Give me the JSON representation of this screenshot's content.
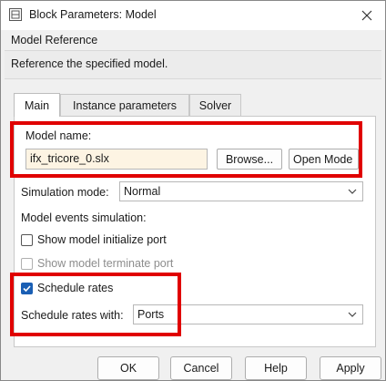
{
  "window": {
    "title": "Block Parameters: Model",
    "close_icon": "close-icon"
  },
  "group": {
    "title": "Model Reference",
    "description": "Reference the specified model."
  },
  "tabs": [
    {
      "label": "Main",
      "active": true
    },
    {
      "label": "Instance parameters",
      "active": false
    },
    {
      "label": "Solver",
      "active": false
    }
  ],
  "main": {
    "model_name_label": "Model name:",
    "model_name_value": "ifx_tricore_0.slx",
    "browse_label": "Browse...",
    "open_model_label": "Open Mode",
    "simulation_mode_label": "Simulation mode:",
    "simulation_mode_value": "Normal",
    "model_events_label": "Model events simulation:",
    "show_init_port_label": "Show model initialize port",
    "show_init_port_checked": false,
    "show_term_port_label": "Show model terminate port",
    "show_term_port_checked": false,
    "show_term_port_enabled": false,
    "schedule_rates_label": "Schedule rates",
    "schedule_rates_checked": true,
    "schedule_rates_with_label": "Schedule rates with:",
    "schedule_rates_with_value": "Ports"
  },
  "buttons": {
    "ok": "OK",
    "cancel": "Cancel",
    "help": "Help",
    "apply": "Apply"
  },
  "colors": {
    "highlight": "#e00000",
    "checkbox_checked": "#1a5fb4",
    "model_field_bg": "#fdf4e3"
  }
}
